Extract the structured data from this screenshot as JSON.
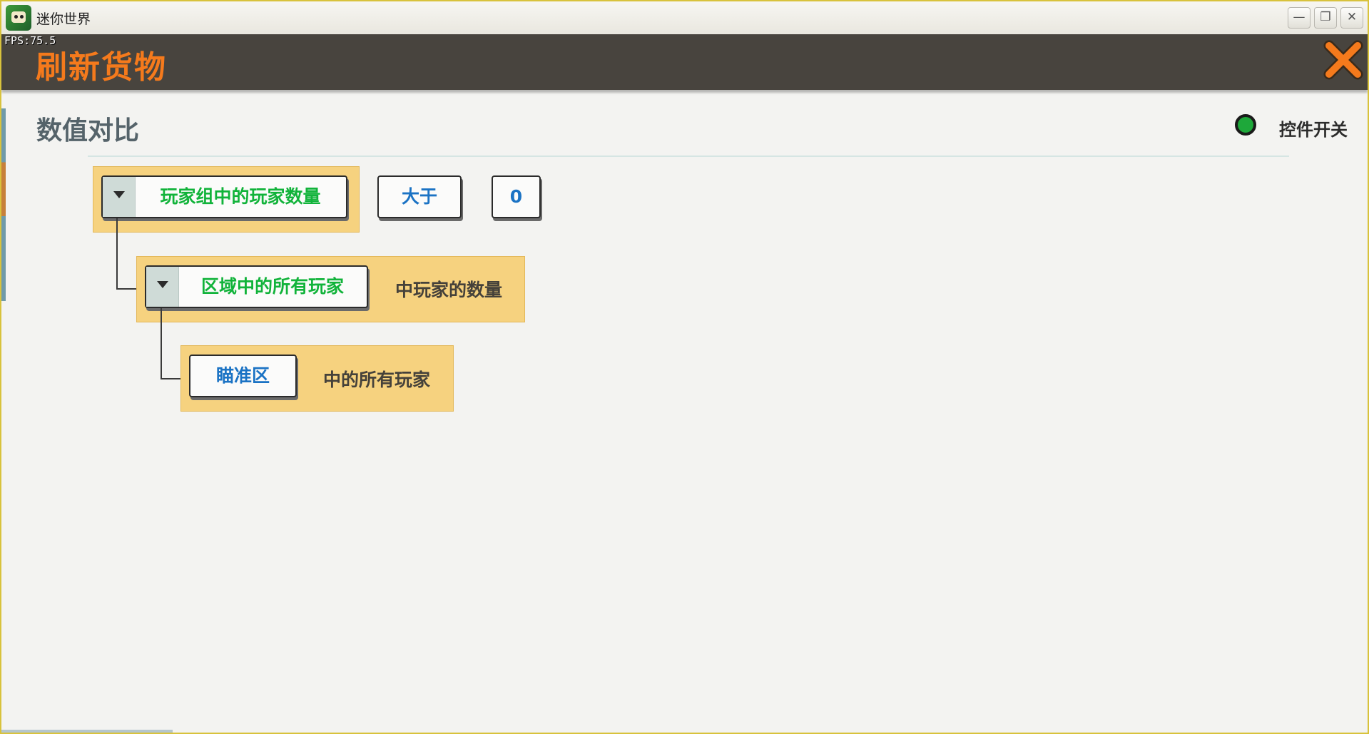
{
  "window": {
    "app_title": "迷你世界",
    "fps": "FPS:75.5",
    "minimize_symbol": "—",
    "restore_symbol": "❐",
    "close_symbol": "✕"
  },
  "panel": {
    "title": "刷新货物",
    "close_icon": "close-x-icon"
  },
  "section": {
    "title": "数值对比",
    "toggle_label": "控件开关",
    "toggle_color": "#1ea83a"
  },
  "rows": {
    "row1": {
      "dropdown_label": "玩家组中的玩家数量",
      "operator": "大于",
      "value": "0"
    },
    "row2": {
      "dropdown_label": "区域中的所有玩家",
      "suffix": "中玩家的数量"
    },
    "row3": {
      "button_label": "瞄准区",
      "suffix": "中的所有玩家"
    }
  },
  "colors": {
    "header_bg": "#48443e",
    "title_orange": "#f57a1c",
    "row_bg": "#f6d27f",
    "green_text": "#11b33a",
    "blue_text": "#1b73c4"
  }
}
